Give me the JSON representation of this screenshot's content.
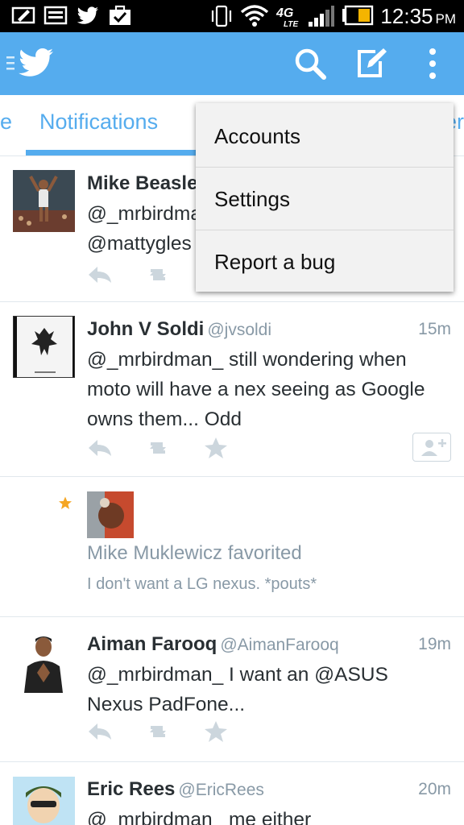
{
  "status_bar": {
    "time": "12:35",
    "ampm": "PM",
    "network": "4G LTE",
    "left_icons": [
      "edit-icon",
      "image-icon",
      "twitter-icon",
      "briefcase-check-icon"
    ],
    "right_icons": [
      "vibrate-icon",
      "wifi-icon",
      "signal-icon",
      "battery-icon"
    ]
  },
  "app_bar": {
    "brand_color": "#55acee",
    "icons": [
      "twitter-bird-icon",
      "search-icon",
      "compose-icon",
      "overflow-menu-icon"
    ]
  },
  "tabs": {
    "left_partial": "e",
    "active": "Notifications",
    "right_partial": "er"
  },
  "menu": {
    "items": [
      "Accounts",
      "Settings",
      "Report a bug"
    ]
  },
  "feed": {
    "items": [
      {
        "name": "Mike Beasle",
        "line2": "@_mrbirdma",
        "line3": "@mattygles"
      },
      {
        "name": "John V Soldi",
        "handle": "@jvsoldi",
        "time": "15m",
        "text": "@_mrbirdman_ still wondering when moto will have a nex seeing as Google owns them... Odd"
      },
      {
        "title": "Mike Muklewicz favorited",
        "text": "I don't want a LG nexus. *pouts*"
      },
      {
        "name": "Aiman Farooq",
        "handle": "@AimanFarooq",
        "time": "19m",
        "text": "@_mrbirdman_ I want an @ASUS Nexus PadFone..."
      },
      {
        "name": "Eric Rees",
        "handle": "@EricRees",
        "time": "20m",
        "text": "@_mrbirdman_ me either"
      }
    ]
  }
}
